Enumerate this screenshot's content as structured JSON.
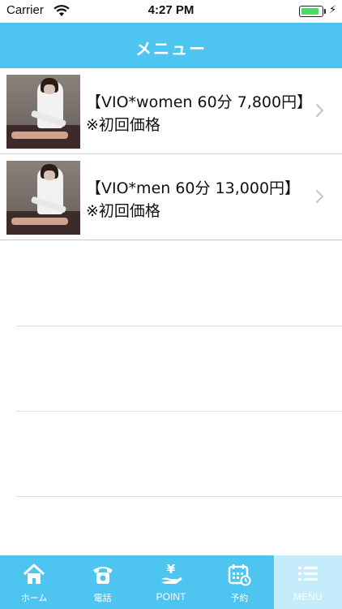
{
  "status_bar": {
    "carrier": "Carrier",
    "time": "4:27 PM",
    "battery_level": 0.9
  },
  "header": {
    "title": "メニュー"
  },
  "menu_items": [
    {
      "title": "【VIO*women 60分 7,800円】※初回価格"
    },
    {
      "title": "【VIO*men 60分 13,000円】※初回価格"
    }
  ],
  "tab_bar": {
    "tabs": [
      {
        "label": "ホーム",
        "icon": "home-icon"
      },
      {
        "label": "電話",
        "icon": "phone-icon"
      },
      {
        "label": "POINT",
        "icon": "yen-hand-icon"
      },
      {
        "label": "予約",
        "icon": "calendar-icon"
      },
      {
        "label": "MENU",
        "icon": "menu-list-icon"
      }
    ],
    "active_tab": "MENU",
    "colors": {
      "bar": "#4ec4f0",
      "active": "#c4ecfb"
    }
  }
}
